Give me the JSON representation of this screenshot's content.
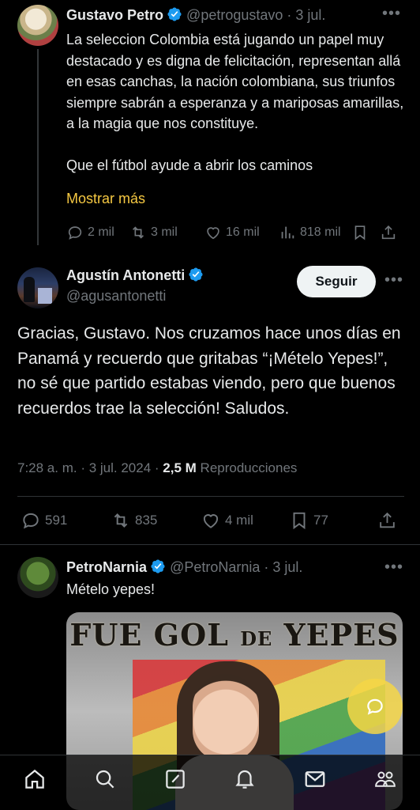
{
  "tweet1": {
    "name": "Gustavo Petro",
    "handle": "@petrogustavo",
    "date": "· 3 jul.",
    "text": "La seleccion Colombia está jugando un papel muy destacado y es digna de felicitación, representan allá en esas canchas, la nación colombiana, sus triunfos siempre sabrán a esperanza y a mariposas amarillas, a la magia que nos constituye.\n\nQue el fútbol ayude a abrir los caminos",
    "show_more": "Mostrar más",
    "replies": "2 mil",
    "reposts": "3 mil",
    "likes": "16 mil",
    "views": "818 mil"
  },
  "tweet2": {
    "name": "Agustín Antonetti",
    "handle": "@agusantonetti",
    "follow_label": "Seguir",
    "text": "Gracias, Gustavo. Nos cruzamos hace unos días en Panamá y recuerdo que gritabas “¡Mételo Yepes!”, no sé que partido estabas viendo, pero que buenos recuerdos trae la selección! Saludos.",
    "time": "7:28 a. m.",
    "date": "3 jul. 2024",
    "views_count": "2,5 M",
    "views_label": "Reproducciones",
    "replies": "591",
    "reposts": "835",
    "likes": "4 mil",
    "bookmarks": "77"
  },
  "tweet3": {
    "name": "PetroNarnia",
    "handle": "@PetroNarnia",
    "date": "· 3 jul.",
    "text": "Mételo yepes!",
    "media_title_a": "FUE GOL",
    "media_title_b": "DE",
    "media_title_c": "YEPES"
  },
  "colors": {
    "accent_link": "#f5c842",
    "verified": "#1d9bf0",
    "background": "#000000",
    "muted": "#71767b"
  },
  "icons": [
    "home-icon",
    "search-icon",
    "compose-icon",
    "notifications-icon",
    "messages-icon",
    "communities-icon"
  ]
}
